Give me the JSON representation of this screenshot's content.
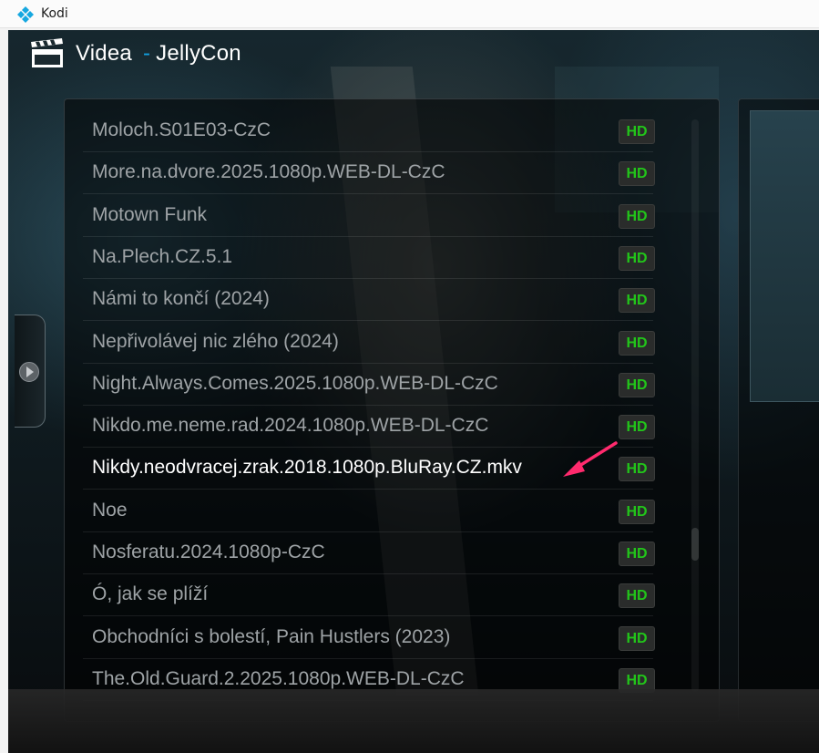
{
  "window": {
    "title": "Kodi",
    "logo_icon": "kodi-logo-icon"
  },
  "header": {
    "icon": "clapperboard-icon",
    "title": "Videa",
    "separator": "-",
    "subtitle": "JellyCon"
  },
  "list": {
    "items": [
      {
        "label": "Moloch.S01E03-CzC",
        "badge": "HD"
      },
      {
        "label": "More.na.dvore.2025.1080p.WEB-DL-CzC",
        "badge": "HD"
      },
      {
        "label": "Motown Funk",
        "badge": "HD"
      },
      {
        "label": "Na.Plech.CZ.5.1",
        "badge": "HD"
      },
      {
        "label": "Námi to končí (2024)",
        "badge": "HD"
      },
      {
        "label": "Nepřivolávej nic zlého (2024)",
        "badge": "HD"
      },
      {
        "label": "Night.Always.Comes.2025.1080p.WEB-DL-CzC",
        "badge": "HD"
      },
      {
        "label": "Nikdo.me.neme.rad.2024.1080p.WEB-DL-CzC",
        "badge": "HD"
      },
      {
        "label": "Nikdy.neodvracej.zrak.2018.1080p.BluRay.CZ.mkv",
        "badge": "HD",
        "focused": true
      },
      {
        "label": "Noe",
        "badge": "HD"
      },
      {
        "label": "Nosferatu.2024.1080p-CzC",
        "badge": "HD"
      },
      {
        "label": "Ó, jak se plíží",
        "badge": "HD"
      },
      {
        "label": "Obchodníci s bolestí, Pain Hustlers (2023)",
        "badge": "HD"
      },
      {
        "label": "The.Old.Guard.2.2025.1080p.WEB-DL-CzC",
        "badge": "HD"
      }
    ]
  },
  "colors": {
    "accent": "#12a0e0",
    "hd_badge_text": "#22c51a",
    "focused_text": "#ffffff",
    "item_text": "#9ea3a6",
    "annotation_arrow": "#ff2a6d"
  },
  "icons": {
    "side_arrow": "chevron-right-icon",
    "annotation": "pointer-arrow-icon"
  }
}
